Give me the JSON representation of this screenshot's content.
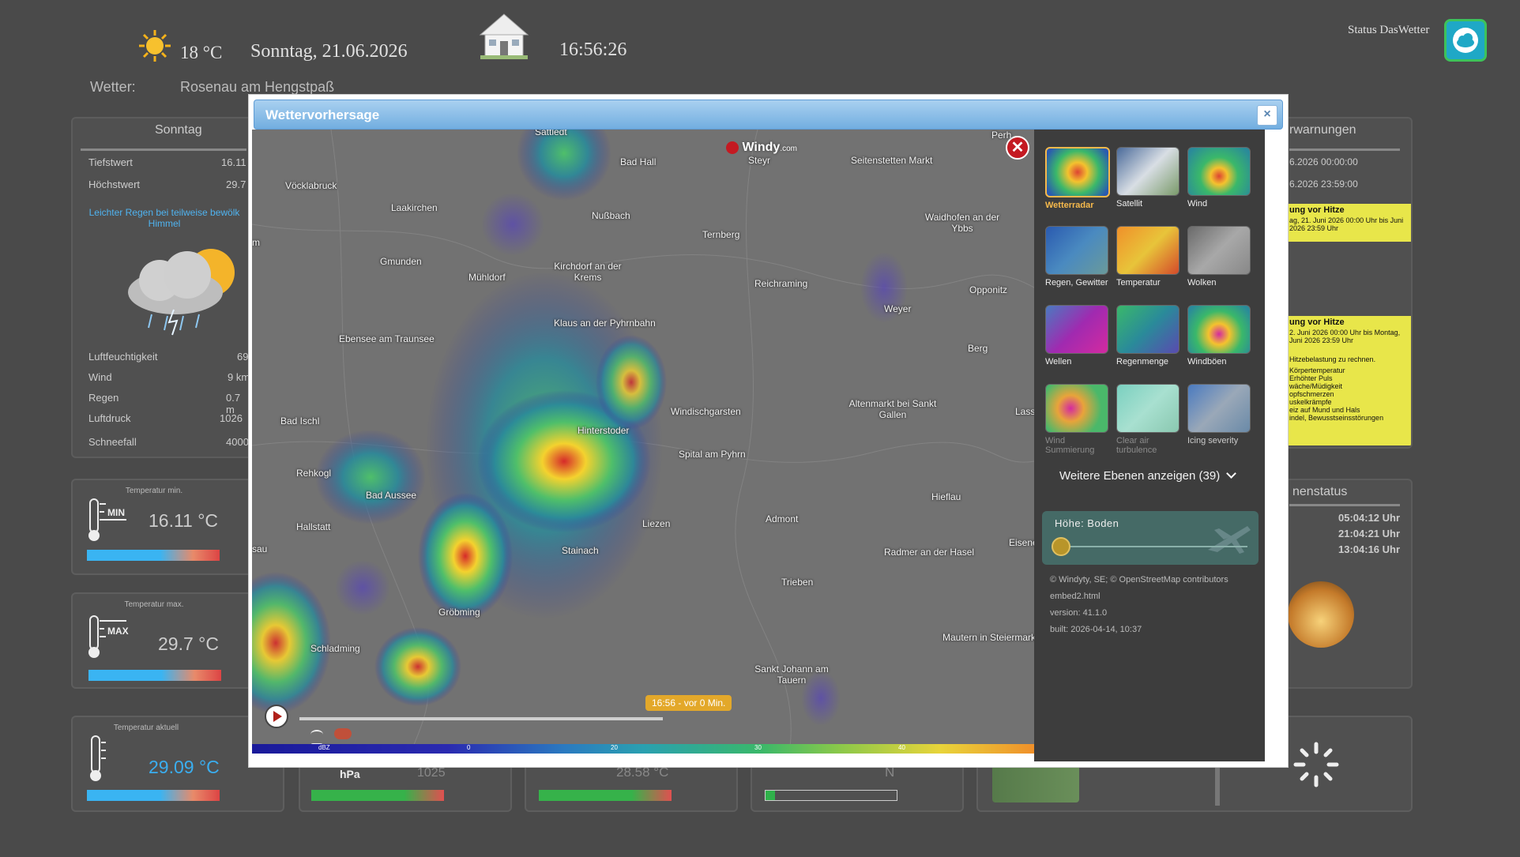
{
  "header": {
    "temperature": "18 °C",
    "date": "Sonntag, 21.06.2026",
    "time": "16:56:26",
    "weather_label": "Wetter:",
    "location": "Rosenau am Hengstpaß",
    "status_label": "Status DasWetter",
    "icons": {
      "sun": "sun-icon",
      "home": "house-icon",
      "status": "cloud-status-icon"
    }
  },
  "left_panel": {
    "day": "Sonntag",
    "tiefstwert_label": "Tiefstwert",
    "tiefstwert_value": "16.11",
    "hoechstwert_label": "Höchstwert",
    "hoechstwert_value": "29.7",
    "description": "Leichter Regen bei teilweise bewölk Himmel",
    "rows": [
      {
        "label": "Luftfeuchtigkeit",
        "value": "69"
      },
      {
        "label": "Wind",
        "value": "9 km"
      },
      {
        "label": "Regen",
        "value": "0.7 m"
      },
      {
        "label": "Luftdruck",
        "value": "1026"
      },
      {
        "label": "Schneefall",
        "value": "4000"
      }
    ]
  },
  "tiles": {
    "temp_min": {
      "caption": "Temperatur min.",
      "badge": "MIN",
      "value": "16.11 °C"
    },
    "temp_max": {
      "caption": "Temperatur max.",
      "badge": "MAX",
      "value": "29.7 °C"
    },
    "temp_now": {
      "caption": "Temperatur aktuell",
      "value": "29.09 °C"
    },
    "pressure": {
      "unit": "hPa",
      "value": "1025"
    },
    "other_value": "28.58 °C",
    "wind_dir": "N"
  },
  "right_panel": {
    "title": "rwarnungen",
    "date1": "6.2026 00:00:00",
    "date2": "6.2026 23:59:00",
    "warn1_title": "ung vor Hitze",
    "warn1_text": "ag, 21. Juni 2026 00:00 Uhr bis Juni 2026 23:59 Uhr",
    "warn2_title": "ung vor Hitze",
    "warn2_text": "2. Juni 2026 00:00 Uhr bis Montag, Juni 2026 23:59 Uhr",
    "warn2_body": "Hitzebelastung zu rechnen.",
    "warn2_list": [
      "Körpertemperatur",
      "Erhöhter Puls",
      "wäche/Müdigkeit",
      "opfschmerzen",
      "uskelkrämpfe",
      "eiz auf Mund und Hals",
      "indel, Bewusstseinsstörungen"
    ]
  },
  "sun_panel": {
    "title": "nenstatus",
    "sunrise": "05:04:12 Uhr",
    "sunset": "21:04:21 Uhr",
    "daylength": "13:04:16 Uhr"
  },
  "modal": {
    "title": "Wettervorhersage",
    "close_label": "×",
    "windy_logo": "Windy",
    "windy_logo_suffix": ".com",
    "map_towns": [
      "Sattledt",
      "Bad Hall",
      "Steyr",
      "Seitenstetten Markt",
      "Vöcklabruck",
      "Laakirchen",
      "Nußbach",
      "Waidhofen an der Ybbs",
      "Ternberg",
      "Gmunden",
      "Mühldorf",
      "Kirchdorf an der Krems",
      "Reichraming",
      "Opponitz",
      "Weyer",
      "Klaus an der Pyhrnbahn",
      "Ebensee am Traunsee",
      "Berg",
      "Windischgarsten",
      "Altenmarkt bei Sankt Gallen",
      "Bad Ischl",
      "Hinterstoder",
      "Spital am Pyhrn",
      "Rehkogl",
      "Bad Aussee",
      "Hieflau",
      "Hallstatt",
      "Liezen",
      "Admont",
      "Stainach",
      "Radmer an der Hasel",
      "Trieben",
      "Gröbming",
      "Mautern in Steiermark",
      "Schladming",
      "Sankt Johann am Tauern",
      "Lass",
      "Eisene",
      "Perh",
      "m",
      "sau"
    ],
    "timeline_label": "16:56 - vor 0 Min.",
    "scale_unit": "dBZ",
    "scale_ticks": [
      "0",
      "20",
      "30",
      "40"
    ],
    "layers": [
      {
        "name": "Wetterradar",
        "selected": true
      },
      {
        "name": "Satellit"
      },
      {
        "name": "Wind"
      },
      {
        "name": "Regen, Gewitter"
      },
      {
        "name": "Temperatur"
      },
      {
        "name": "Wolken"
      },
      {
        "name": "Wellen"
      },
      {
        "name": "Regenmenge"
      },
      {
        "name": "Windböen"
      },
      {
        "name": "Wind Summierung",
        "dim": true
      },
      {
        "name": "Clear air turbulence",
        "dim": true
      },
      {
        "name": "Icing severity"
      }
    ],
    "more_layers": "Weitere Ebenen anzeigen (39)",
    "height_label": "Höhe: Boden",
    "credits": "© Windyty, SE; © OpenStreetMap contributors",
    "embed": "embed2.html",
    "version": "version: 41.1.0",
    "built": "built: 2026-04-14, 10:37"
  }
}
